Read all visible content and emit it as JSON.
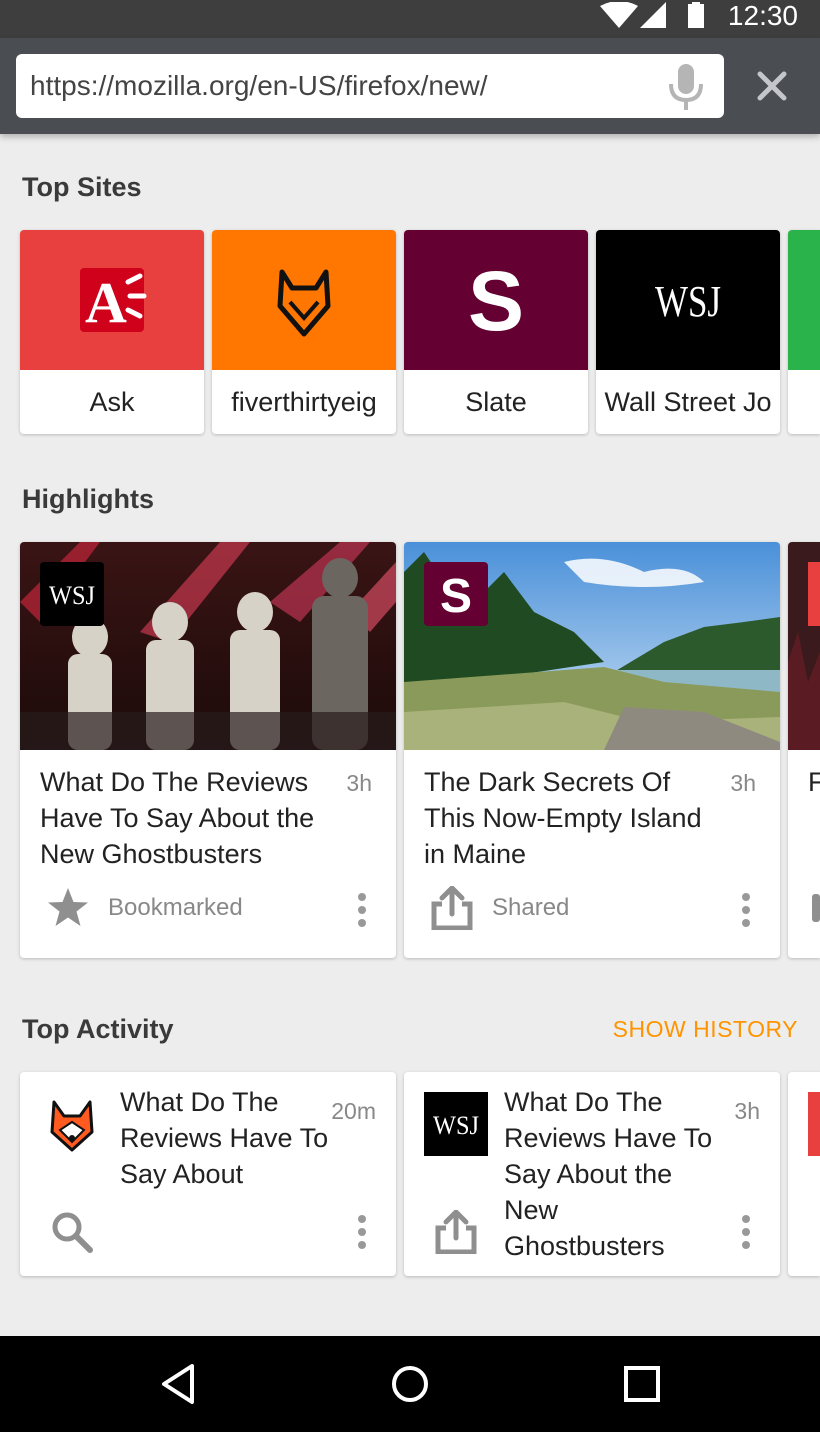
{
  "status_bar": {
    "time": "12:30",
    "icons": [
      "wifi-icon",
      "cell-signal-icon",
      "battery-icon"
    ]
  },
  "toolbar": {
    "url": "https://mozilla.org/en-US/firefox/new/",
    "mic_icon": "microphone-icon",
    "close_icon": "close-icon"
  },
  "top_sites": {
    "title": "Top Sites",
    "items": [
      {
        "label": "Ask",
        "color": "#e8403f",
        "logo": "A"
      },
      {
        "label": "fiverthirtyeig",
        "color": "#ff7700",
        "logo": "fox-icon"
      },
      {
        "label": "Slate",
        "color": "#640032",
        "logo": "S"
      },
      {
        "label": "Wall Street Jo",
        "color": "#000000",
        "logo": "WSJ"
      },
      {
        "label": "",
        "color": "#2ab34b",
        "logo": ""
      }
    ]
  },
  "highlights": {
    "title": "Highlights",
    "items": [
      {
        "title": "What Do The Reviews Have To Say About the New Ghostbusters",
        "time": "3h",
        "status": "Bookmarked",
        "status_icon": "star-icon",
        "badge": "WSJ"
      },
      {
        "title": "The Dark Secrets Of This Now-Empty Island in Maine",
        "time": "3h",
        "status": "Shared",
        "status_icon": "share-icon",
        "badge": "S"
      },
      {
        "title": "F",
        "time": "",
        "status": "",
        "status_icon": "",
        "badge": ""
      }
    ]
  },
  "top_activity": {
    "title": "Top Activity",
    "show_history": "SHOW HISTORY",
    "items": [
      {
        "title": "What Do The Reviews Have To Say About",
        "time": "20m",
        "status_icon": "search-icon",
        "logo": "fox-icon"
      },
      {
        "title": "What Do The Reviews Have To Say About the New Ghostbusters",
        "time": "3h",
        "status_icon": "share-icon",
        "logo": "WSJ"
      }
    ]
  },
  "colors": {
    "accent": "#ff9400",
    "toolbar": "#4a4d52",
    "background": "#ededed"
  },
  "navbar": {
    "icons": [
      "back-icon",
      "home-icon",
      "recents-icon"
    ]
  }
}
